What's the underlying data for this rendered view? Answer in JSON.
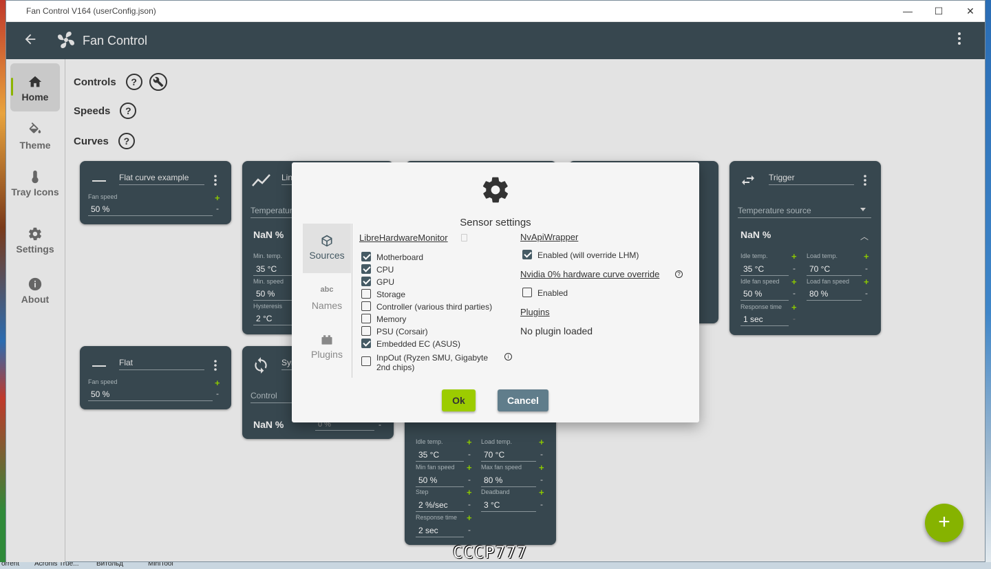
{
  "window": {
    "title": "Fan Control V164 (userConfig.json)",
    "minimize": "—",
    "maximize": "☐",
    "close": "✕"
  },
  "appbar": {
    "title": "Fan Control"
  },
  "nav": [
    {
      "label": "Home",
      "icon": "home-icon"
    },
    {
      "label": "Theme",
      "icon": "paint-bucket-icon"
    },
    {
      "label": "Tray Icons",
      "icon": "thermometer-icon"
    },
    {
      "label": "Settings",
      "icon": "gear-icon"
    },
    {
      "label": "About",
      "icon": "info-icon"
    }
  ],
  "sections": {
    "controls": "Controls",
    "speeds": "Speeds",
    "curves": "Curves",
    "help": "?"
  },
  "cards": {
    "flat_example": {
      "name": "Flat curve example",
      "fan_speed_label": "Fan speed",
      "fan_speed": "50 %"
    },
    "linear": {
      "name": "Line",
      "source": "Temperature",
      "value": "NaN %",
      "min_temp_label": "Min. temp.",
      "min_temp": "35 °C",
      "min_speed_label": "Min. speed",
      "min_speed": "50 %",
      "hysteresis_label": "Hysteresis",
      "hysteresis": "2 °C"
    },
    "flat": {
      "name": "Flat",
      "fan_speed_label": "Fan speed",
      "fan_speed": "50 %"
    },
    "sync": {
      "name": "Sync",
      "control": "Control",
      "value": "NaN %",
      "offset": "0 %"
    },
    "trigger": {
      "name": "Trigger",
      "source": "Temperature source",
      "value": "NaN %",
      "idle_temp_label": "Idle temp.",
      "idle_temp": "35 °C",
      "load_temp_label": "Load temp.",
      "load_temp": "70 °C",
      "idle_speed_label": "Idle fan speed",
      "idle_speed": "50 %",
      "load_speed_label": "Load fan speed",
      "load_speed": "80 %",
      "response_label": "Response time",
      "response": "1 sec"
    },
    "auto": {
      "idle_temp_label": "Idle temp.",
      "idle_temp": "35 °C",
      "load_temp_label": "Load temp.",
      "load_temp": "70 °C",
      "min_speed_label": "Min fan speed",
      "min_speed": "50 %",
      "max_speed_label": "Max fan speed",
      "max_speed": "80 %",
      "step_label": "Step",
      "step": "2 %/sec",
      "deadband_label": "Deadband",
      "deadband": "3 °C",
      "response_label": "Response time",
      "response": "2 sec"
    }
  },
  "dialog": {
    "title": "Sensor settings",
    "tabs": [
      {
        "label": "Sources"
      },
      {
        "label": "Names"
      },
      {
        "label": "Plugins"
      }
    ],
    "lhm_title": "LibreHardwareMonitor",
    "lhm_items": [
      {
        "label": "Motherboard",
        "checked": true
      },
      {
        "label": "CPU",
        "checked": true
      },
      {
        "label": "GPU",
        "checked": true
      },
      {
        "label": "Storage",
        "checked": false
      },
      {
        "label": "Controller (various third parties)",
        "checked": false
      },
      {
        "label": "Memory",
        "checked": false
      },
      {
        "label": "PSU (Corsair)",
        "checked": false
      },
      {
        "label": "Embedded EC (ASUS)",
        "checked": true
      },
      {
        "label": "InpOut (Ryzen SMU, Gigabyte 2nd chips)",
        "checked": false
      }
    ],
    "nvapi_title": "NvApiWrapper",
    "nvapi_enabled": "Enabled (will override LHM)",
    "nvidia_title": "Nvidia 0% hardware curve override",
    "nvidia_enabled": "Enabled",
    "plugins_title": "Plugins",
    "plugins_status": "No plugin loaded",
    "ok": "Ok",
    "cancel": "Cancel"
  },
  "taskbar": [
    "orrent",
    "Acronis True...",
    "Витольд",
    "MiniTool"
  ],
  "watermark": "СССР777",
  "colors": {
    "accent": "#86b300",
    "card": "#37474f",
    "appbar": "#37474f"
  }
}
